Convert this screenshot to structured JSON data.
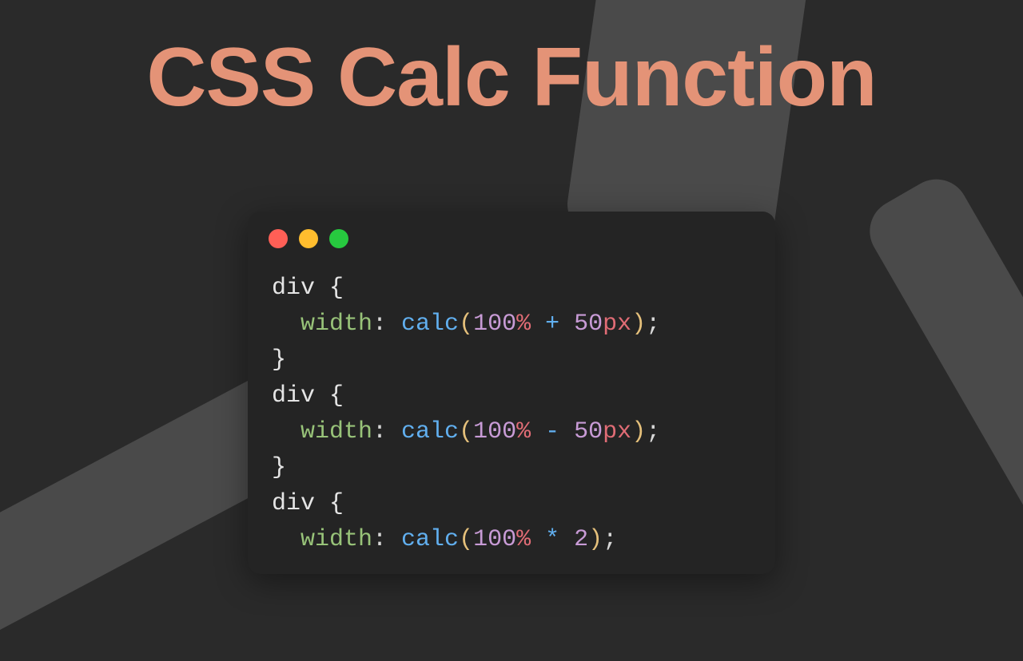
{
  "title": "CSS Calc Function",
  "traffic_lights": {
    "red": "#ff5f56",
    "yellow": "#ffbd2e",
    "green": "#27c93f"
  },
  "code_lines": {
    "l0": "div {",
    "l1_prop": "width",
    "l1_func": "calc",
    "l1_a_val": "100",
    "l1_a_unit": "%",
    "l1_op": "+",
    "l1_b_val": "50",
    "l1_b_unit": "px",
    "l2": "}",
    "l3": "div {",
    "l4_prop": "width",
    "l4_func": "calc",
    "l4_a_val": "100",
    "l4_a_unit": "%",
    "l4_op": "-",
    "l4_b_val": "50",
    "l4_b_unit": "px",
    "l5": "}",
    "l6": "div {",
    "l7_prop": "width",
    "l7_func": "calc",
    "l7_a_val": "100",
    "l7_a_unit": "%",
    "l7_op": "*",
    "l7_b_val": "2",
    "l7_b_unit": ""
  },
  "colors": {
    "bg": "#2a2a2a",
    "shape": "#4a4a4a",
    "editor_bg": "#242424",
    "title": "#e49377",
    "prop": "#98c379",
    "func": "#61afef",
    "num": "#c89bd6",
    "unit": "#e06c75",
    "paren": "#e5c07b",
    "text": "#d8d8d8"
  }
}
